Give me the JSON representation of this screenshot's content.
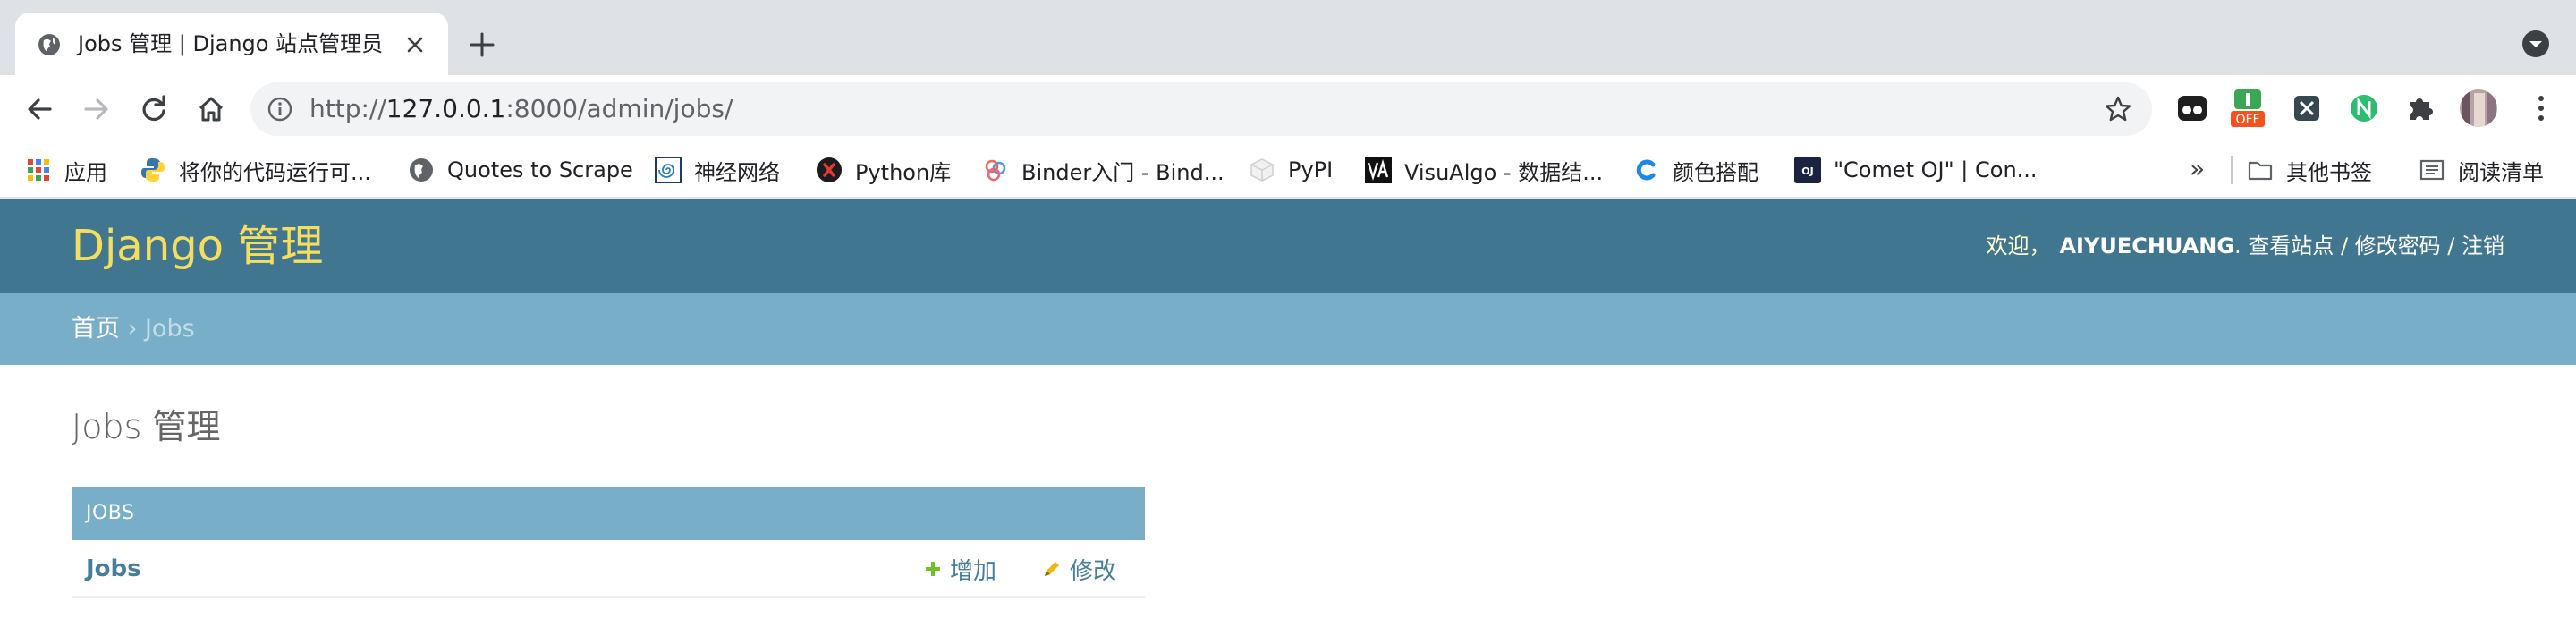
{
  "browser": {
    "tab": {
      "title": "Jobs 管理 | Django 站点管理员"
    },
    "address_bar": {
      "url_scheme": "http://",
      "url_host": "127.0.0.1",
      "url_rest": ":8000/admin/jobs/"
    },
    "extensions": [
      {
        "icon": "goggles-extension-icon"
      },
      {
        "icon": "off-toggle-extension-icon",
        "badge": "OFF"
      },
      {
        "icon": "x-extension-icon"
      },
      {
        "icon": "n-extension-icon"
      },
      {
        "icon": "puzzle-extensions-icon"
      },
      {
        "icon": "profile-avatar"
      }
    ],
    "bookmarks": {
      "items": [
        {
          "label": "应用",
          "icon": "apps-grid-icon"
        },
        {
          "label": "将你的代码运行可...",
          "icon": "python-logo-icon"
        },
        {
          "label": "Quotes to Scrape",
          "icon": "globe-icon"
        },
        {
          "label": "神经网络",
          "icon": "spiral-icon"
        },
        {
          "label": "Python库",
          "icon": "red-x-icon"
        },
        {
          "label": "Binder入门 - Bind...",
          "icon": "binder-rings-icon"
        },
        {
          "label": "PyPI",
          "icon": "pypi-cube-icon"
        },
        {
          "label": "VisuAlgo - 数据结...",
          "icon": "visualgo-icon"
        },
        {
          "label": "颜色搭配",
          "icon": "c-logo-icon"
        },
        {
          "label": "\"Comet OJ\" | Con...",
          "icon": "oj-logo-icon"
        }
      ],
      "overflow": "»",
      "other_bookmarks": "其他书签",
      "reading_list": "阅读清单"
    }
  },
  "admin": {
    "branding": "Django 管理",
    "user_tools": {
      "welcome": "欢迎，",
      "username": "AIYUECHUANG",
      "after_username": ". ",
      "view_site": "查看站点",
      "separator": " / ",
      "change_password": "修改密码",
      "logout": "注销"
    },
    "breadcrumbs": {
      "home": "首页",
      "separator": " › ",
      "current": "Jobs"
    },
    "page_title": "Jobs 管理",
    "module": {
      "caption": "JOBS",
      "rows": [
        {
          "model": "Jobs",
          "add_label": "增加",
          "change_label": "修改"
        }
      ]
    },
    "colors": {
      "header": "#417690",
      "breadcrumbs": "#79aec8",
      "branding": "#f5dd5d",
      "link": "#447e9b",
      "add_icon": "#70bf2b",
      "change_icon": "#efb80b"
    }
  }
}
